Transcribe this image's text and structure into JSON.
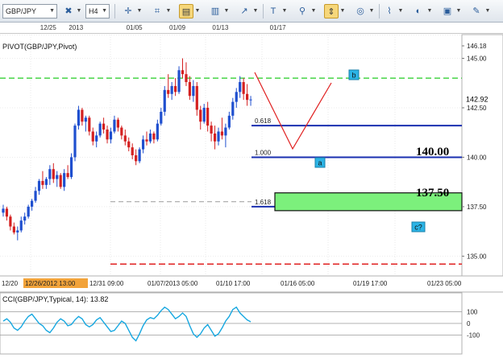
{
  "toolbar": {
    "symbol": "GBP/JPY",
    "timeframe": "H4",
    "buttons": [
      {
        "name": "crosshair-icon",
        "glyph": "✛"
      },
      {
        "name": "indicator-icon",
        "glyph": "⌗"
      },
      {
        "name": "chart-type-icon",
        "glyph": "▤",
        "active": true
      },
      {
        "name": "bar-chart-icon",
        "glyph": "▥"
      },
      {
        "name": "draw-line-icon",
        "glyph": "↗"
      },
      {
        "name": "text-tool-icon",
        "glyph": "T"
      },
      {
        "name": "zoom-icon",
        "glyph": "⚲"
      },
      {
        "name": "cursor-tool-icon",
        "glyph": "⇕",
        "active": true
      },
      {
        "name": "object-icon",
        "glyph": "◎"
      },
      {
        "name": "ruler-icon",
        "glyph": "⌇"
      },
      {
        "name": "theme-icon",
        "glyph": "◐"
      },
      {
        "name": "picture-icon",
        "glyph": "▣"
      },
      {
        "name": "settings-icon",
        "glyph": "✎"
      }
    ]
  },
  "top_axis_labels": [
    {
      "text": "12/25",
      "x": 2
    },
    {
      "text": "2013",
      "x": 6
    },
    {
      "text": "01/05",
      "x": 14
    },
    {
      "text": "01/09",
      "x": 20
    },
    {
      "text": "01/13",
      "x": 26
    },
    {
      "text": "01/17",
      "x": 34
    }
  ],
  "chart_data": [
    {
      "type": "candlestick",
      "title": "PIVOT(GBP/JPY,Pivot)",
      "symbol": "GBP/JPY",
      "timeframe": "H4",
      "last_price": "142.92",
      "ylim": [
        134.0,
        146.2
      ],
      "y_ticks": [
        "146.18",
        "145.00",
        "142.50",
        "140.00",
        "137.50",
        "135.00"
      ],
      "x_ticks": [
        {
          "label": "12/20",
          "x": 0
        },
        {
          "label": "12/26/2012 13:00",
          "x": 4,
          "highlight": true
        },
        {
          "label": "12/31 09:00",
          "x": 8
        },
        {
          "label": "01/07/2013 05:00",
          "x": 14
        },
        {
          "label": "01/10 17:00",
          "x": 21
        },
        {
          "label": "01/16 05:00",
          "x": 28
        },
        {
          "label": "01/19 17:00",
          "x": 35
        },
        {
          "label": "01/23 05:00",
          "x": 40
        }
      ],
      "levels": [
        {
          "name": "upper-green-dashed",
          "y": 144.0,
          "style": "green-dashed"
        },
        {
          "name": "lower-red-dashed",
          "y": 134.6,
          "style": "red-dashed"
        },
        {
          "name": "gray-dashed",
          "y": 137.75,
          "style": "gray-dashed"
        },
        {
          "name": "fib-0618",
          "y": 141.6,
          "label": "0.618",
          "style": "blue"
        },
        {
          "name": "fib-1000",
          "y": 140.0,
          "label": "1.000",
          "style": "blue"
        },
        {
          "name": "fib-1618",
          "y": 137.5,
          "label": "1.618",
          "style": "blue"
        }
      ],
      "annotations": {
        "level_140": "140.00",
        "level_1375": "137.50",
        "wave_a": "a",
        "wave_b": "b",
        "wave_c": "c?"
      },
      "target_zone": {
        "y_top": 138.2,
        "y_bottom": 137.3
      },
      "candles": [
        [
          137.2,
          137.6,
          137.0,
          137.4
        ],
        [
          137.4,
          137.5,
          136.8,
          137.0
        ],
        [
          137.0,
          137.1,
          136.3,
          136.5
        ],
        [
          136.5,
          136.7,
          136.1,
          136.2
        ],
        [
          136.2,
          136.5,
          135.8,
          136.3
        ],
        [
          136.3,
          137.0,
          136.2,
          136.8
        ],
        [
          136.8,
          137.2,
          136.6,
          137.0
        ],
        [
          137.0,
          137.6,
          136.9,
          137.5
        ],
        [
          137.5,
          137.9,
          137.3,
          137.8
        ],
        [
          137.8,
          138.5,
          137.7,
          138.3
        ],
        [
          138.3,
          138.9,
          138.1,
          138.8
        ],
        [
          138.8,
          139.3,
          138.4,
          138.6
        ],
        [
          138.6,
          139.0,
          138.4,
          138.9
        ],
        [
          138.9,
          139.6,
          138.6,
          139.4
        ],
        [
          139.4,
          139.7,
          138.7,
          138.9
        ],
        [
          138.9,
          139.3,
          138.5,
          139.1
        ],
        [
          139.1,
          139.2,
          138.4,
          138.5
        ],
        [
          138.5,
          139.4,
          138.3,
          139.2
        ],
        [
          139.2,
          139.6,
          138.9,
          139.0
        ],
        [
          139.0,
          140.2,
          138.9,
          140.0
        ],
        [
          140.0,
          141.7,
          139.8,
          141.6
        ],
        [
          141.6,
          142.6,
          141.4,
          142.4
        ],
        [
          142.4,
          142.5,
          141.6,
          141.8
        ],
        [
          141.8,
          142.1,
          141.3,
          142.0
        ],
        [
          142.0,
          142.1,
          141.1,
          141.3
        ],
        [
          141.3,
          141.5,
          140.6,
          140.8
        ],
        [
          140.8,
          141.3,
          140.5,
          141.1
        ],
        [
          141.1,
          141.8,
          141.0,
          141.7
        ],
        [
          141.7,
          142.0,
          141.2,
          141.4
        ],
        [
          141.4,
          141.6,
          140.7,
          140.9
        ],
        [
          140.9,
          141.5,
          140.7,
          141.3
        ],
        [
          141.3,
          142.1,
          141.2,
          141.9
        ],
        [
          141.9,
          142.0,
          141.3,
          141.5
        ],
        [
          141.5,
          141.6,
          140.9,
          141.1
        ],
        [
          141.1,
          141.4,
          140.6,
          140.8
        ],
        [
          140.8,
          141.0,
          140.3,
          140.5
        ],
        [
          140.5,
          140.7,
          139.9,
          140.1
        ],
        [
          140.1,
          140.4,
          139.6,
          139.8
        ],
        [
          139.8,
          140.5,
          139.7,
          140.4
        ],
        [
          140.4,
          141.1,
          140.2,
          140.9
        ],
        [
          140.9,
          141.3,
          140.6,
          140.8
        ],
        [
          140.8,
          141.4,
          140.7,
          141.2
        ],
        [
          141.2,
          141.3,
          140.7,
          140.9
        ],
        [
          140.9,
          141.9,
          140.8,
          141.7
        ],
        [
          141.7,
          142.5,
          141.6,
          142.3
        ],
        [
          142.3,
          143.6,
          142.1,
          143.4
        ],
        [
          143.4,
          144.2,
          143.0,
          143.2
        ],
        [
          143.2,
          143.8,
          142.9,
          143.6
        ],
        [
          143.6,
          144.0,
          143.1,
          143.3
        ],
        [
          143.3,
          144.6,
          143.2,
          144.4
        ],
        [
          144.4,
          145.0,
          144.0,
          144.2
        ],
        [
          144.2,
          144.8,
          143.6,
          143.8
        ],
        [
          143.8,
          144.1,
          142.9,
          143.1
        ],
        [
          143.1,
          143.9,
          142.8,
          143.6
        ],
        [
          143.6,
          143.8,
          142.1,
          142.4
        ],
        [
          142.4,
          142.6,
          141.4,
          141.8
        ],
        [
          141.8,
          142.7,
          141.7,
          142.5
        ],
        [
          142.5,
          142.8,
          141.3,
          141.6
        ],
        [
          141.6,
          141.8,
          140.8,
          141.2
        ],
        [
          141.2,
          141.6,
          140.4,
          140.8
        ],
        [
          140.8,
          141.5,
          140.6,
          141.3
        ],
        [
          141.3,
          142.0,
          140.9,
          141.1
        ],
        [
          141.1,
          141.7,
          140.5,
          141.5
        ],
        [
          141.5,
          142.3,
          141.4,
          142.1
        ],
        [
          142.1,
          143.0,
          141.9,
          142.8
        ],
        [
          142.8,
          143.5,
          142.5,
          143.3
        ],
        [
          143.3,
          144.1,
          143.0,
          143.8
        ],
        [
          143.8,
          144.0,
          142.9,
          143.2
        ],
        [
          143.2,
          143.7,
          142.6,
          142.9
        ],
        [
          142.9,
          143.1,
          142.6,
          142.92
        ]
      ]
    },
    {
      "type": "line",
      "title": "CCI(GBP/JPY,Typical, 14): 13.82",
      "ylim": [
        -250,
        250
      ],
      "y_ticks": [
        "100",
        "0",
        "-100"
      ],
      "values": [
        20,
        40,
        10,
        -40,
        -60,
        -30,
        20,
        60,
        80,
        40,
        0,
        -20,
        -60,
        -80,
        -40,
        10,
        40,
        20,
        -20,
        -10,
        30,
        60,
        40,
        -10,
        -30,
        -10,
        30,
        50,
        10,
        -30,
        -70,
        -60,
        -20,
        20,
        0,
        -60,
        -120,
        -150,
        -90,
        -20,
        30,
        50,
        40,
        70,
        110,
        140,
        120,
        80,
        40,
        60,
        90,
        60,
        -20,
        -90,
        -120,
        -90,
        -40,
        -10,
        -60,
        -110,
        -90,
        -40,
        20,
        60,
        120,
        140,
        90,
        60,
        30,
        13.82
      ]
    }
  ]
}
